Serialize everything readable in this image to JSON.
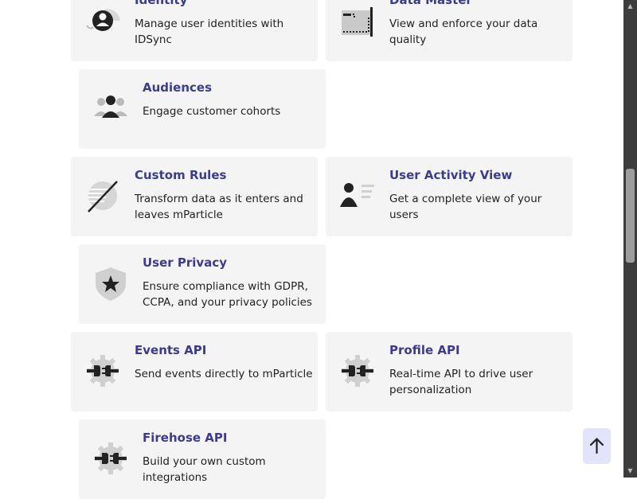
{
  "cards": [
    {
      "title": "Identity",
      "desc": "Manage user identities with IDSync",
      "icon": "identity-icon"
    },
    {
      "title": "Data Master",
      "desc": "View and enforce your data quality",
      "icon": "data-master-icon"
    },
    {
      "title": "Audiences",
      "desc": "Engage customer cohorts",
      "icon": "audiences-icon"
    },
    {
      "title": "Custom Rules",
      "desc": "Transform data as it enters and leaves mParticle",
      "icon": "custom-rules-icon"
    },
    {
      "title": "User Activity View",
      "desc": "Get a complete view of your users",
      "icon": "user-activity-icon"
    },
    {
      "title": "User Privacy",
      "desc": "Ensure compliance with GDPR, CCPA, and your privacy policies",
      "icon": "shield-star-icon"
    },
    {
      "title": "Events API",
      "desc": "Send events directly to mParticle",
      "icon": "plug-gear-icon"
    },
    {
      "title": "Profile API",
      "desc": "Real-time API to drive user personalization",
      "icon": "plug-gear-icon"
    },
    {
      "title": "Firehose API",
      "desc": "Build your own custom integrations",
      "icon": "plug-gear-icon"
    }
  ],
  "back_to_top": {
    "icon": "arrow-up-icon"
  },
  "colors": {
    "card_bg": "#f4f4f4",
    "title": "#3b3b8f",
    "back_to_top_bg": "#e3e3fb"
  }
}
